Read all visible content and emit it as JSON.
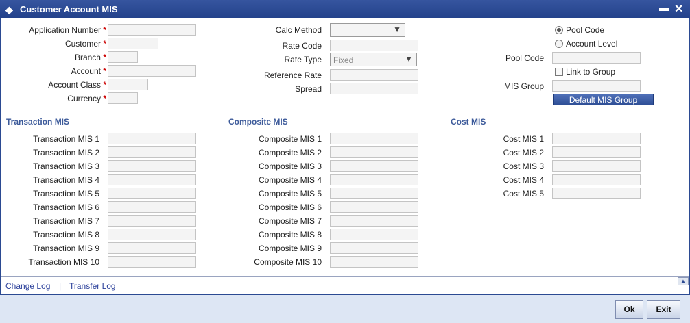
{
  "window": {
    "title": "Customer Account MIS",
    "minimize_icon": "minimize-icon",
    "close_icon": "close-icon"
  },
  "form": {
    "application_number_label": "Application Number",
    "customer_label": "Customer",
    "branch_label": "Branch",
    "account_label": "Account",
    "account_class_label": "Account Class",
    "currency_label": "Currency",
    "required_mark": "*",
    "calc_method_label": "Calc Method",
    "rate_code_label": "Rate Code",
    "rate_type_label": "Rate Type",
    "rate_type_value": "Fixed",
    "reference_rate_label": "Reference Rate",
    "spread_label": "Spread",
    "pool_code_radio_label": "Pool Code",
    "account_level_radio_label": "Account Level",
    "pool_code_label": "Pool Code",
    "link_to_group_label": "Link to Group",
    "mis_group_label": "MIS Group",
    "default_mis_group_button": "Default MIS Group"
  },
  "sections": {
    "transaction": {
      "title": "Transaction MIS",
      "labels": [
        "Transaction MIS 1",
        "Transaction MIS 2",
        "Transaction MIS 3",
        "Transaction MIS 4",
        "Transaction MIS 5",
        "Transaction MIS 6",
        "Transaction MIS 7",
        "Transaction MIS 8",
        "Transaction MIS 9",
        "Transaction MIS 10"
      ]
    },
    "composite": {
      "title": "Composite MIS",
      "labels": [
        "Composite MIS 1",
        "Composite MIS 2",
        "Composite MIS 3",
        "Composite MIS 4",
        "Composite MIS 5",
        "Composite MIS 6",
        "Composite MIS 7",
        "Composite MIS 8",
        "Composite MIS 9",
        "Composite MIS 10"
      ]
    },
    "cost": {
      "title": "Cost MIS",
      "labels": [
        "Cost MIS 1",
        "Cost MIS 2",
        "Cost MIS 3",
        "Cost MIS 4",
        "Cost MIS 5"
      ]
    }
  },
  "footer": {
    "change_log": "Change Log",
    "separator": "|",
    "transfer_log": "Transfer Log",
    "ok": "Ok",
    "exit": "Exit"
  }
}
